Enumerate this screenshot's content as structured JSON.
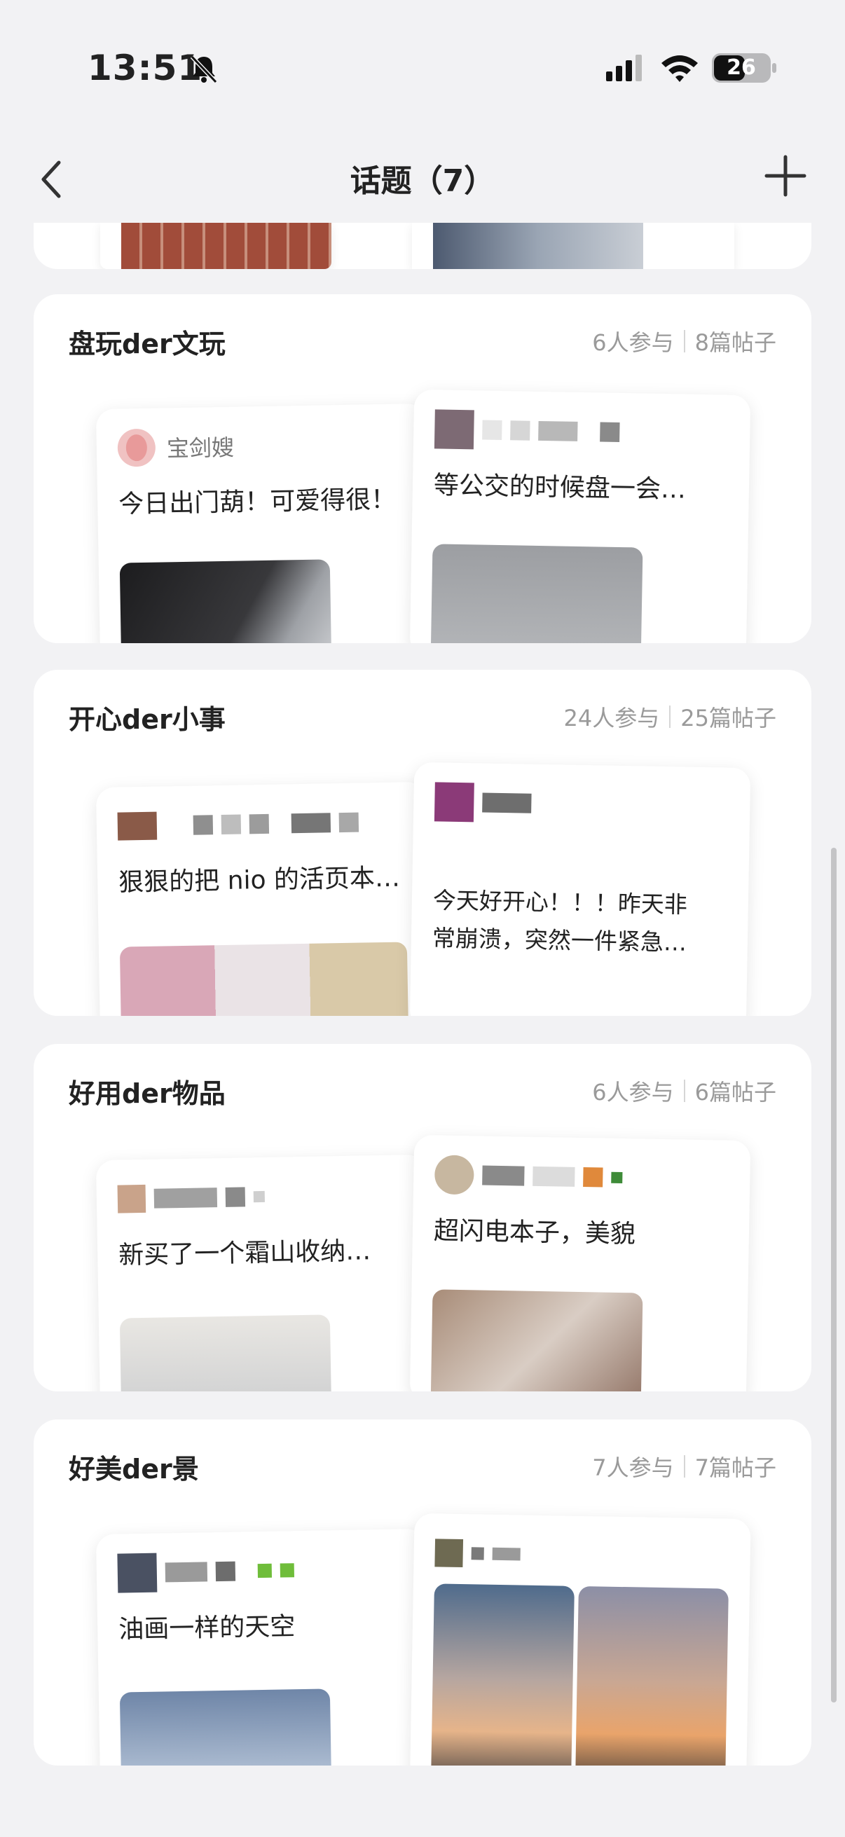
{
  "status_bar": {
    "time": "13:51",
    "battery": "26"
  },
  "nav": {
    "title": "话题（7）"
  },
  "topics": [
    {
      "name": "盘玩der文玩",
      "participants": "6人参与",
      "posts": "8篇帖子",
      "left_post": {
        "author": "宝剑嫂",
        "text": "今日出门葫！可爱得很！"
      },
      "right_post": {
        "text": "等公交的时候盘一会…"
      }
    },
    {
      "name": "开心der小事",
      "participants": "24人参与",
      "posts": "25篇帖子",
      "left_post": {
        "text": "狠狠的把 nio 的活页本…"
      },
      "right_post": {
        "text_line1": "今天好开心！！！昨天非",
        "text_line2": "常崩溃，突然一件紧急…"
      }
    },
    {
      "name": "好用der物品",
      "participants": "6人参与",
      "posts": "6篇帖子",
      "left_post": {
        "text": "新买了一个霜山收纳…"
      },
      "right_post": {
        "text": "超闪电本子，美貌"
      }
    },
    {
      "name": "好美der景",
      "participants": "7人参与",
      "posts": "7篇帖子",
      "left_post": {
        "text": "油画一样的天空"
      },
      "right_post": {
        "text": ""
      }
    }
  ],
  "icons": {
    "back": "chevron-left-icon",
    "add": "plus-icon",
    "bell": "bell-slash-icon",
    "signal": "signal-icon",
    "wifi": "wifi-icon"
  }
}
